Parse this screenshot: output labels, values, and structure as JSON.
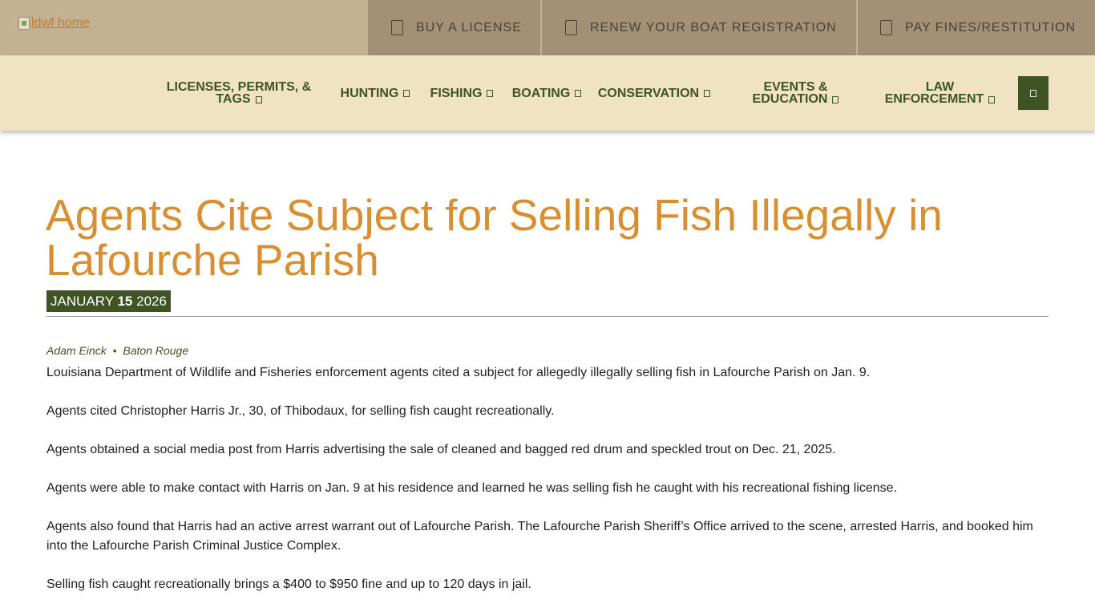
{
  "header": {
    "logo_alt": "ldwf home",
    "quick_links": [
      {
        "label": "BUY A LICENSE",
        "icon": "document-icon"
      },
      {
        "label": "RENEW YOUR BOAT REGISTRATION",
        "icon": "document-icon"
      },
      {
        "label": "PAY FINES/RESTITUTION",
        "icon": "document-icon"
      }
    ]
  },
  "nav": {
    "items": [
      {
        "line1": "LICENSES, PERMITS, &",
        "line2": "TAGS"
      },
      {
        "line1": "HUNTING",
        "line2": ""
      },
      {
        "line1": "FISHING",
        "line2": ""
      },
      {
        "line1": "BOATING",
        "line2": ""
      },
      {
        "line1": "CONSERVATION",
        "line2": ""
      },
      {
        "line1": "EVENTS &",
        "line2": "EDUCATION"
      },
      {
        "line1": "LAW",
        "line2": "ENFORCEMENT"
      }
    ],
    "search_icon": "search-icon"
  },
  "article": {
    "title": "Agents Cite Subject for Selling Fish Illegally in Lafourche Parish",
    "date": {
      "month": "JANUARY",
      "day": "15",
      "year": "2026"
    },
    "author": "Adam Einck",
    "separator": "•",
    "location": "Baton Rouge",
    "paragraphs": [
      "Louisiana Department of Wildlife and Fisheries enforcement agents cited a subject for allegedly illegally selling fish in Lafourche Parish on Jan. 9.",
      "Agents cited Christopher Harris Jr., 30, of Thibodaux, for selling fish caught recreationally.",
      "Agents obtained a social media post from Harris advertising the sale of cleaned and bagged red drum and speckled trout on Dec. 21, 2025.",
      "Agents were able to make contact with Harris on Jan. 9 at his residence and learned he was selling fish he caught with his recreational fishing license.",
      "Agents also found that Harris had an active arrest warrant out of Lafourche Parish. The Lafourche Parish Sheriff’s Office arrived to the scene, arrested Harris, and booked him into the Lafourche Parish Criminal Justice Complex.",
      "Selling fish caught recreationally brings a $400 to $950 fine and up to 120 days in jail."
    ]
  },
  "colors": {
    "topbar": "#c2b193",
    "quick_link_bg": "#a39077",
    "nav_bg": "#efe3c3",
    "brand_green": "#3f5424",
    "title_orange": "#d88f32"
  }
}
